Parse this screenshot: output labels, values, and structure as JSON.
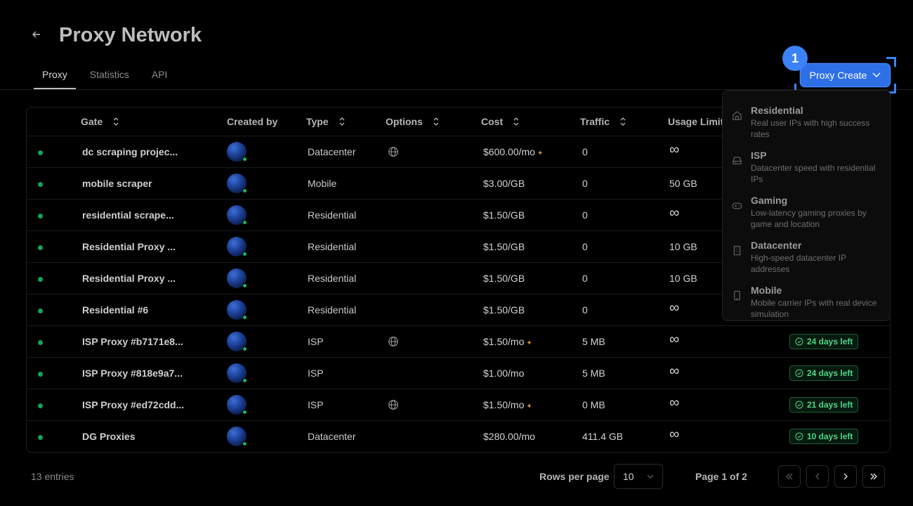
{
  "header": {
    "title": "Proxy Network",
    "tabs": [
      {
        "label": "Proxy",
        "active": true
      },
      {
        "label": "Statistics",
        "active": false
      },
      {
        "label": "API",
        "active": false
      }
    ],
    "create_button": "Proxy Create",
    "step_badge": "1"
  },
  "table": {
    "columns": {
      "gate": "Gate",
      "created_by": "Created by",
      "type": "Type",
      "options": "Options",
      "cost": "Cost",
      "traffic": "Traffic",
      "usage_limit": "Usage Limit"
    },
    "rows": [
      {
        "gate": "dc scraping projec...",
        "type": "Datacenter",
        "cost": "$600.00/mo",
        "plus": true,
        "globe": true,
        "traffic": "0",
        "limit": "∞",
        "days": ""
      },
      {
        "gate": "mobile scraper",
        "type": "Mobile",
        "cost": "$3.00/GB",
        "plus": false,
        "globe": false,
        "traffic": "0",
        "limit": "50 GB",
        "days": ""
      },
      {
        "gate": "residential scrape...",
        "type": "Residential",
        "cost": "$1.50/GB",
        "plus": false,
        "globe": false,
        "traffic": "0",
        "limit": "∞",
        "days": ""
      },
      {
        "gate": "Residential Proxy ...",
        "type": "Residential",
        "cost": "$1.50/GB",
        "plus": false,
        "globe": false,
        "traffic": "0",
        "limit": "10 GB",
        "days": ""
      },
      {
        "gate": "Residential Proxy ...",
        "type": "Residential",
        "cost": "$1.50/GB",
        "plus": false,
        "globe": false,
        "traffic": "0",
        "limit": "10 GB",
        "days": ""
      },
      {
        "gate": "Residential #6",
        "type": "Residential",
        "cost": "$1.50/GB",
        "plus": false,
        "globe": false,
        "traffic": "0",
        "limit": "∞",
        "days": ""
      },
      {
        "gate": "ISP Proxy #b7171e8...",
        "type": "ISP",
        "cost": "$1.50/mo",
        "plus": true,
        "globe": true,
        "traffic": "5 MB",
        "limit": "∞",
        "days": "24 days left"
      },
      {
        "gate": "ISP Proxy #818e9a7...",
        "type": "ISP",
        "cost": "$1.00/mo",
        "plus": false,
        "globe": false,
        "traffic": "5 MB",
        "limit": "∞",
        "days": "24 days left"
      },
      {
        "gate": "ISP Proxy #ed72cdd...",
        "type": "ISP",
        "cost": "$1.50/mo",
        "plus": true,
        "globe": true,
        "traffic": "0 MB",
        "limit": "∞",
        "days": "21 days left"
      },
      {
        "gate": "DG Proxies",
        "type": "Datacenter",
        "cost": "$280.00/mo",
        "plus": false,
        "globe": false,
        "traffic": "411.4 GB",
        "limit": "∞",
        "days": "10 days left"
      }
    ]
  },
  "dropdown": {
    "items": [
      {
        "title": "Residential",
        "desc": "Real user IPs with high success rates",
        "icon": "home-icon"
      },
      {
        "title": "ISP",
        "desc": "Datacenter speed with residential IPs",
        "icon": "hard-drive-icon"
      },
      {
        "title": "Gaming",
        "desc": "Low-latency gaming proxies by game and location",
        "icon": "gamepad-icon"
      },
      {
        "title": "Datacenter",
        "desc": "High-speed datacenter IP addresses",
        "icon": "building-icon"
      },
      {
        "title": "Mobile",
        "desc": "Mobile carrier IPs with real device simulation",
        "icon": "smartphone-icon"
      }
    ]
  },
  "footer": {
    "entries": "13 entries",
    "rows_per_page_label": "Rows per page",
    "rows_per_page_value": "10",
    "page_info": "Page 1 of 2"
  },
  "colors": {
    "accent": "#2f6fe6",
    "status_green": "#14a35b",
    "days_badge": "#4fd58a"
  }
}
